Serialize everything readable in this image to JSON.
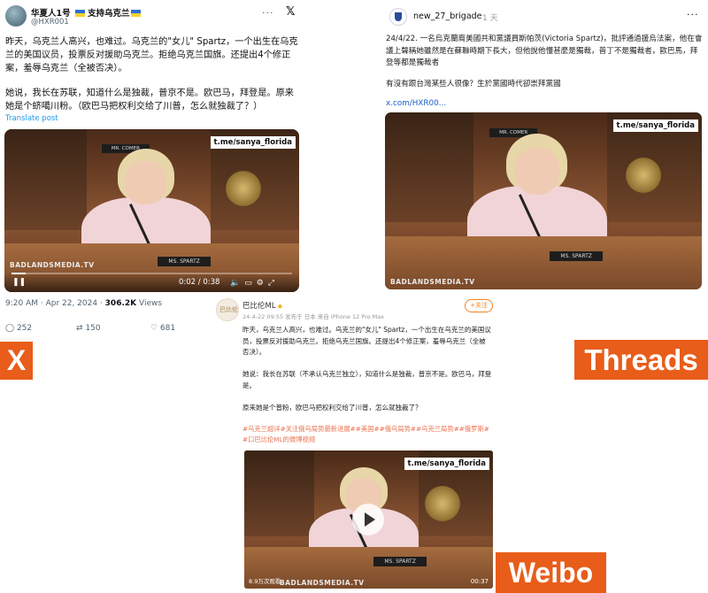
{
  "x_post": {
    "display_name": "华夏人1号",
    "support_text": "支持乌克兰",
    "handle": "@HXR001",
    "more_icon": "ellipsis-icon",
    "text_p1": "昨天，乌克兰人高兴，也难过。乌克兰的\"女儿\" Spartz，一个出生在乌克兰的美国议员，投票反对援助乌克兰。拒绝乌克兰国旗。还提出4个修正案，羞辱乌克兰（全被否决）。",
    "text_p2": "她说，我长在苏联，知道什么是独裁，普京不是。欧巴马，拜登是。原来她是个蛴噶川粉。（欧巴马把权利交给了川普，怎么就独裁了？）",
    "translate": "Translate post",
    "video": {
      "watermark": "t.me/sanya_florida",
      "bottom_mark": "BADLANDSMEDIA.TV",
      "nameplate": "MS. SPARTZ",
      "nameplate_top": "MR. COMER",
      "time": "0:02 / 0:38",
      "progress": 0.05
    },
    "timestamp": "9:20 AM · Apr 22, 2024 · ",
    "views_count": "306.2K",
    "views_label": " Views",
    "replies": "252",
    "reposts": "150",
    "likes": "681",
    "platform_label": "X"
  },
  "threads_post": {
    "username": "new_27_brigade",
    "ago": "1 天",
    "text": "24/4/22. 一名烏克蘭裔美國共和黨議員斯帕茨(Victoria Spartz)，批評通過援烏法案，他在會議上聲稱她雖然是在蘇聯時期下長大，但他說他懂甚麼是獨裁，普丁不是獨裁者，歐巴馬，拜登等都是獨裁者",
    "question": "有沒有跟台灣某些人很像？生於黨國時代卻崇拜黨國",
    "link": "x.com/HXR00...",
    "video": {
      "watermark": "t.me/sanya_florida",
      "bottom_mark": "BADLANDSMEDIA.TV",
      "nameplate": "MS. SPARTZ",
      "nameplate_top": "MR. COMER"
    },
    "platform_label": "Threads"
  },
  "weibo_post": {
    "avatar_text": "巴比伦",
    "username": "巴比伦ML",
    "meta": "24-4-22 09:55 发布于 日本 来自 iPhone 12 Pro Max",
    "follow": "+关注",
    "p1": "昨天，乌克兰人高兴，也难过。乌克兰的\"女儿\" Spartz，一个出生在乌克兰的美国议员，投票反对援助乌克兰。拒绝乌克兰国旗。还提出4个修正案，羞辱乌克兰（全被否决）。",
    "p2": "她说：我长在苏联（不承认乌克兰独立），知道什么是独裁，普京不是。欧巴马，拜登是。",
    "p3": "原来她是个普粉，欧巴马把权利交给了川普，怎么就独裁了？",
    "tags": "#乌克兰超详#关注俄乌局势最新进展##美国##俄乌局势##乌克兰局势##俄罗斯#\n#口巴比伦ML的微博视频",
    "video": {
      "watermark": "t.me/sanya_florida",
      "bottom_mark": "BADLANDSMEDIA.TV",
      "nameplate": "MS. SPARTZ",
      "views": "8.9万次观看",
      "duration": "00:37"
    },
    "platform_label": "Weibo"
  },
  "colors": {
    "label_bg": "#e85d1a",
    "x_link": "#1d9bf0",
    "threads_link": "#1b5fc9",
    "weibo_tag": "#eb7350"
  }
}
